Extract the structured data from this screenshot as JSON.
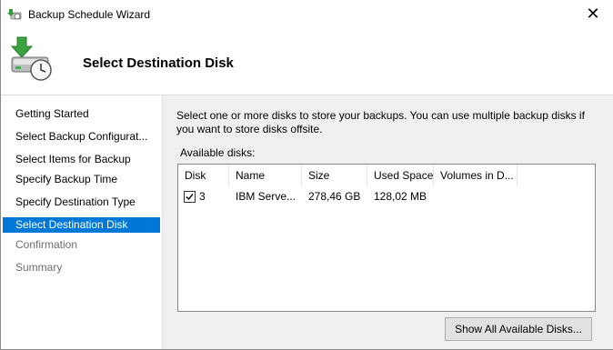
{
  "window": {
    "title": "Backup Schedule Wizard",
    "close_glyph": "✕"
  },
  "header": {
    "title": "Select Destination Disk"
  },
  "sidebar": {
    "steps": [
      {
        "label": "Getting Started",
        "state": "done"
      },
      {
        "label": "Select Backup Configurat...",
        "state": "done"
      },
      {
        "label": "Select Items for Backup",
        "state": "done"
      },
      {
        "label": "Specify Backup Time",
        "state": "done"
      },
      {
        "label": "Specify Destination Type",
        "state": "done"
      },
      {
        "label": "Select Destination Disk",
        "state": "active"
      },
      {
        "label": "Confirmation",
        "state": "disabled"
      },
      {
        "label": "Summary",
        "state": "disabled"
      }
    ]
  },
  "main": {
    "intro": "Select one or more disks to store your backups. You can use multiple backup disks if you want to store disks offsite.",
    "available_label": "Available disks:",
    "columns": [
      "Disk",
      "Name",
      "Size",
      "Used Space",
      "Volumes in D..."
    ],
    "rows": [
      {
        "checked": true,
        "disk": "3",
        "name": "IBM Serve...",
        "size": "278,46 GB",
        "used": "128,02 MB",
        "volumes": ""
      }
    ],
    "show_all_button": "Show All Available Disks..."
  },
  "colors": {
    "accent": "#0078d7",
    "content_bg": "#f0f0f0"
  }
}
